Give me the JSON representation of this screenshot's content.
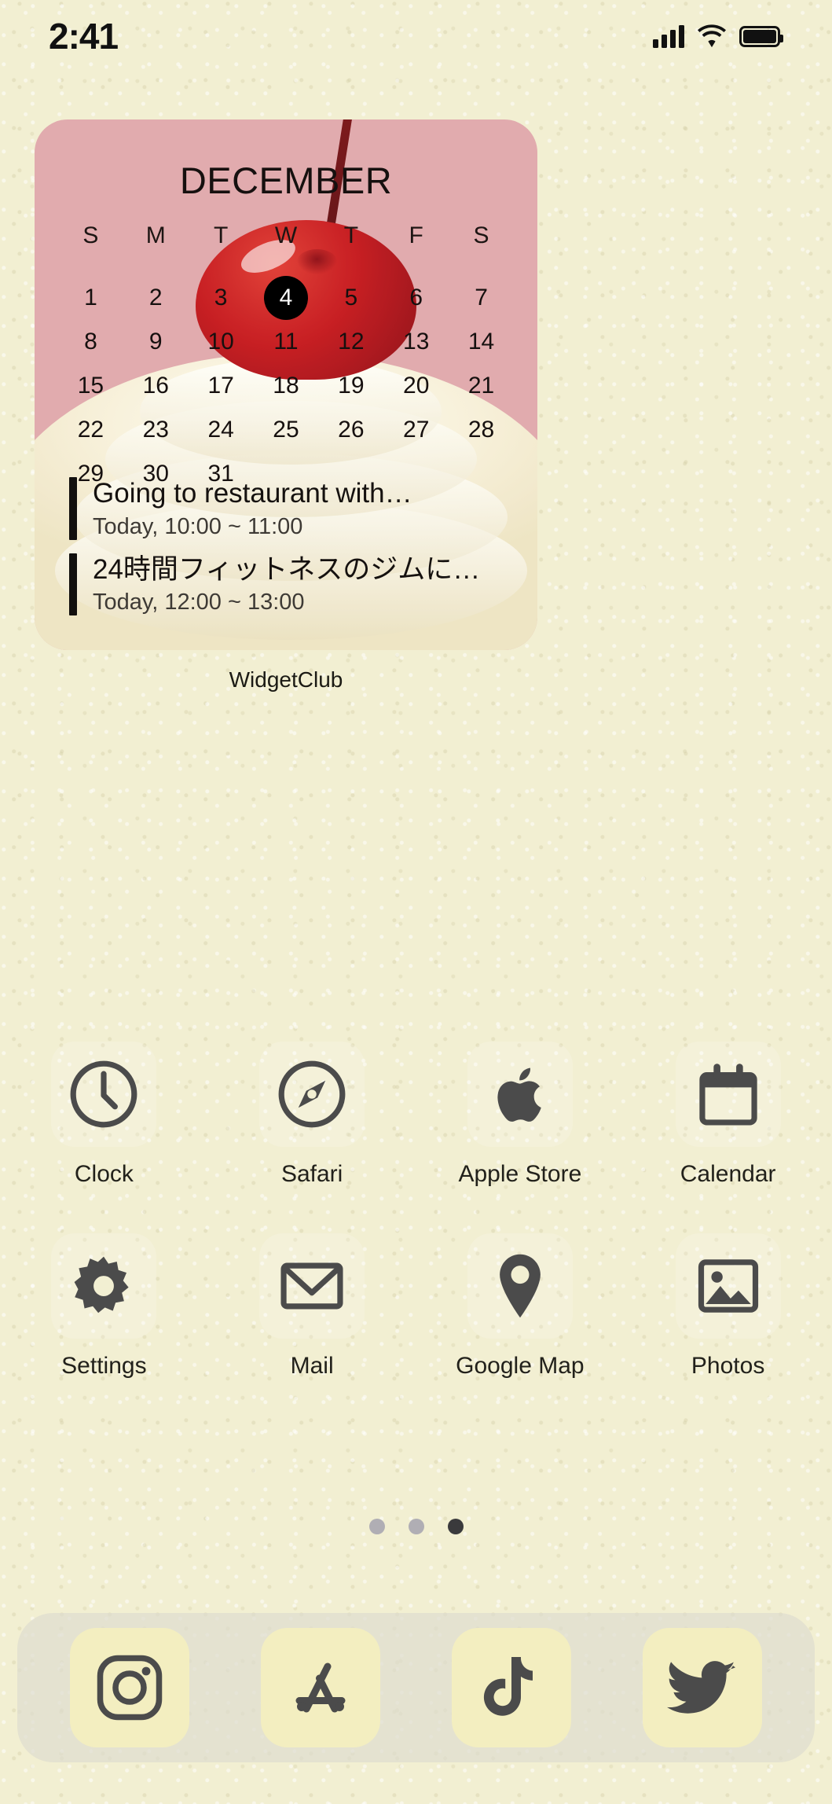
{
  "status_bar": {
    "time": "2:41",
    "signal_icon": "cellular-signal-icon",
    "wifi_icon": "wifi-icon",
    "battery_icon": "battery-icon"
  },
  "widget": {
    "label": "WidgetClub",
    "background_color": "#e0a8ab",
    "accent_color": "#000000",
    "calendar": {
      "month": "DECEMBER",
      "weekday_headers": [
        "S",
        "M",
        "T",
        "W",
        "T",
        "F",
        "S"
      ],
      "leading_blanks": 0,
      "days": [
        1,
        2,
        3,
        4,
        5,
        6,
        7,
        8,
        9,
        10,
        11,
        12,
        13,
        14,
        15,
        16,
        17,
        18,
        19,
        20,
        21,
        22,
        23,
        24,
        25,
        26,
        27,
        28,
        29,
        30,
        31
      ],
      "today": 4
    },
    "events": [
      {
        "title": "Going to restaurant with…",
        "time": "Today, 10:00 ~ 11:00"
      },
      {
        "title": "24時間フィットネスのジムに…",
        "time": "Today, 12:00 ~ 13:00"
      }
    ]
  },
  "app_rows": [
    [
      {
        "label": "Clock",
        "icon": "clock-icon"
      },
      {
        "label": "Safari",
        "icon": "safari-compass-icon"
      },
      {
        "label": "Apple Store",
        "icon": "apple-logo-icon"
      },
      {
        "label": "Calendar",
        "icon": "calendar-icon"
      }
    ],
    [
      {
        "label": "Settings",
        "icon": "gear-icon"
      },
      {
        "label": "Mail",
        "icon": "envelope-icon"
      },
      {
        "label": "Google Map",
        "icon": "map-pin-icon"
      },
      {
        "label": "Photos",
        "icon": "photo-image-icon"
      }
    ]
  ],
  "page_dots": {
    "count": 3,
    "active_index": 2
  },
  "dock": {
    "background_color": "#dedcce",
    "tile_color": "#f3eec0",
    "apps": [
      {
        "name": "Instagram",
        "icon": "instagram-icon"
      },
      {
        "name": "App Store",
        "icon": "app-store-icon"
      },
      {
        "name": "TikTok",
        "icon": "tiktok-icon"
      },
      {
        "name": "Twitter",
        "icon": "twitter-bird-icon"
      }
    ]
  }
}
